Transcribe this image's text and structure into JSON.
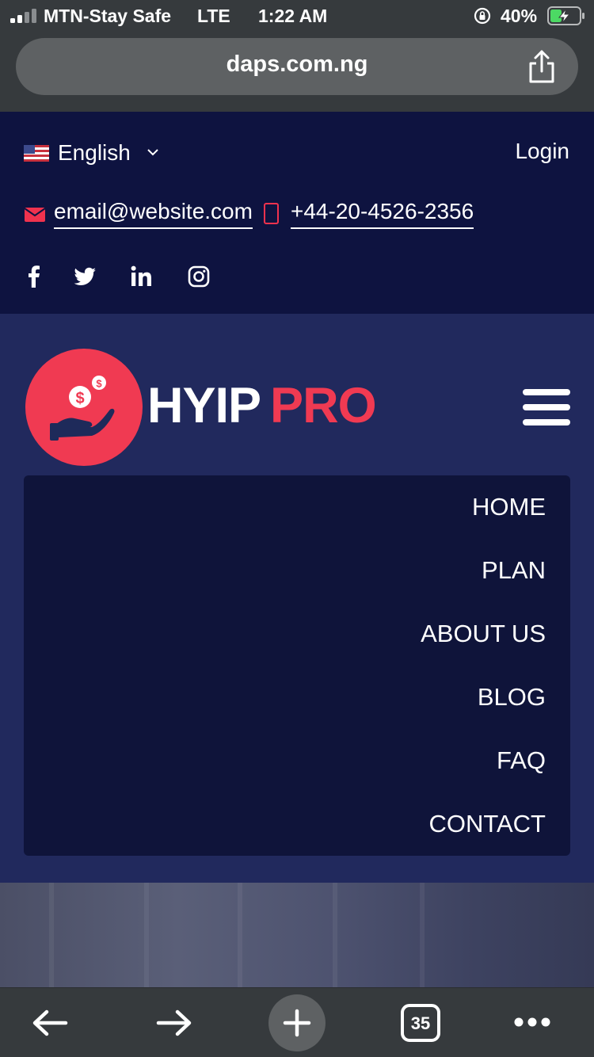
{
  "status_bar": {
    "carrier": "MTN-Stay Safe",
    "network": "LTE",
    "time": "1:22 AM",
    "battery_percent": "40%",
    "battery_level": 0.4
  },
  "browser": {
    "url": "daps.com.ng",
    "open_tabs": "35"
  },
  "topbar": {
    "language": "English",
    "login_label": "Login",
    "email": "email@website.com",
    "phone": "+44-20-4526-2356",
    "social": [
      "facebook-icon",
      "twitter-icon",
      "linkedin-icon",
      "instagram-icon"
    ]
  },
  "brand": {
    "name_part1": "HYIP",
    "name_part2": "PRO",
    "accent_color": "#f03a52",
    "header_bg": "#21295d",
    "topbar_bg": "#0e1340",
    "menu_bg": "#0f143a"
  },
  "menu": {
    "items": [
      {
        "label": "HOME"
      },
      {
        "label": "PLAN"
      },
      {
        "label": "ABOUT US"
      },
      {
        "label": "BLOG"
      },
      {
        "label": "FAQ"
      },
      {
        "label": "CONTACT"
      }
    ]
  }
}
